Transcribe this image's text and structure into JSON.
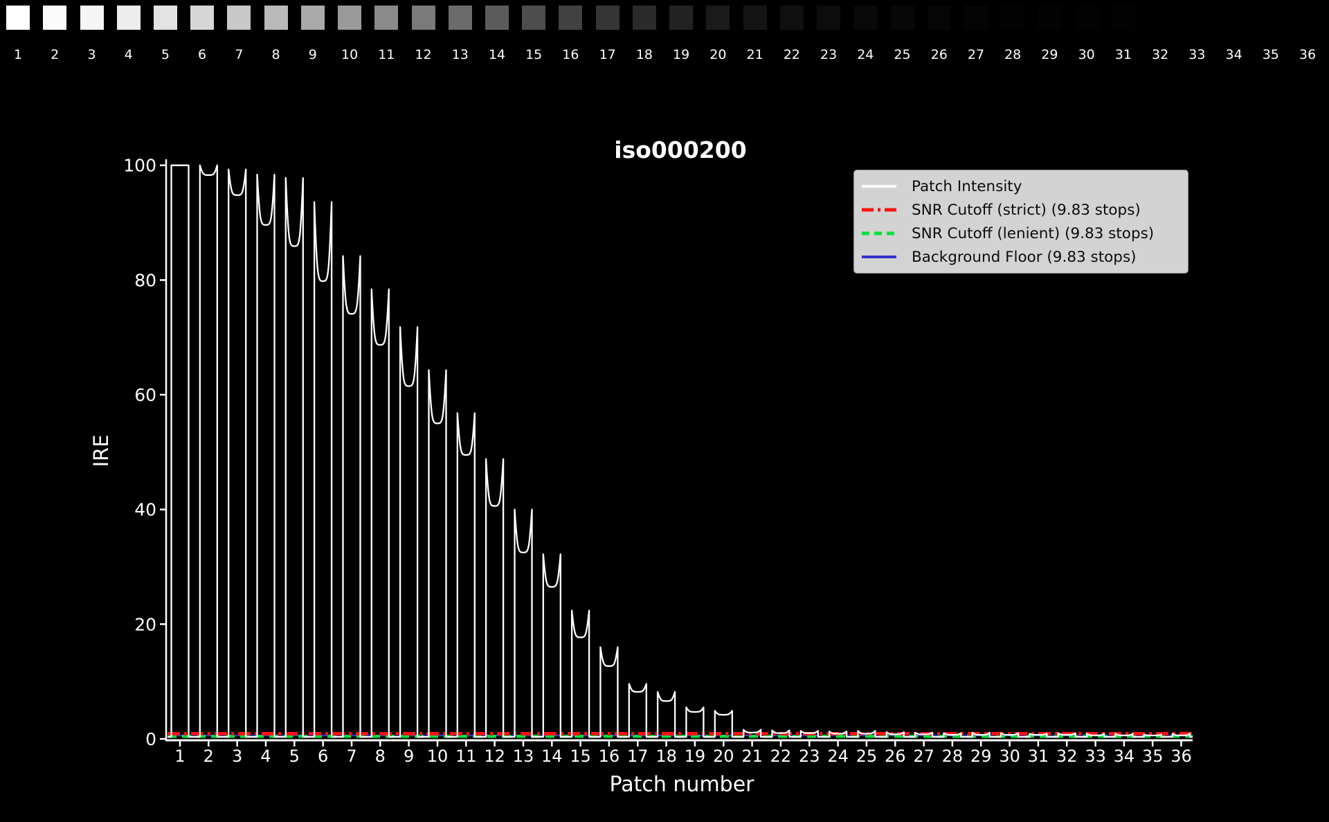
{
  "page": {
    "background": "#000000"
  },
  "patch_strip": {
    "labels": [
      "1",
      "2",
      "3",
      "4",
      "5",
      "6",
      "7",
      "8",
      "9",
      "10",
      "11",
      "12",
      "13",
      "14",
      "15",
      "16",
      "17",
      "18",
      "19",
      "20",
      "21",
      "22",
      "23",
      "24",
      "25",
      "26",
      "27",
      "28",
      "29",
      "30",
      "31",
      "32",
      "33",
      "34",
      "35",
      "36"
    ],
    "shades": [
      "#ffffff",
      "#fbfbfb",
      "#f5f5f5",
      "#ededed",
      "#e3e3e3",
      "#d6d6d6",
      "#c8c8c8",
      "#b9b9b9",
      "#aaaaaa",
      "#9a9a9a",
      "#8a8a8a",
      "#7a7a7a",
      "#6b6b6b",
      "#5c5c5c",
      "#4e4e4e",
      "#414141",
      "#353535",
      "#2b2b2b",
      "#222222",
      "#1a1a1a",
      "#141414",
      "#101010",
      "#0c0c0c",
      "#090909",
      "#070707",
      "#050505",
      "#040404",
      "#030303",
      "#030303",
      "#020202",
      "#020202",
      "#010101",
      "#010101",
      "#010101",
      "#010101",
      "#010101"
    ]
  },
  "chart_data": {
    "type": "line",
    "title": "iso000200",
    "xlabel": "Patch number",
    "ylabel": "IRE",
    "ylim": [
      0,
      100
    ],
    "y_ticks": [
      0,
      20,
      40,
      60,
      80,
      100
    ],
    "x_ticks": [
      1,
      2,
      3,
      4,
      5,
      6,
      7,
      8,
      9,
      10,
      11,
      12,
      13,
      14,
      15,
      16,
      17,
      18,
      19,
      20,
      21,
      22,
      23,
      24,
      25,
      26,
      27,
      28,
      29,
      30,
      31,
      32,
      33,
      34,
      35,
      36
    ],
    "grid": false,
    "background": "#000000",
    "text_color": "#ffffff",
    "legend_position": "upper right",
    "series": [
      {
        "name": "Patch Intensity",
        "kind": "waveform",
        "color": "#ffffff",
        "linestyle": "solid",
        "baseline_ire": 0.35,
        "patch_numbers": [
          1,
          2,
          3,
          4,
          5,
          6,
          7,
          8,
          9,
          10,
          11,
          12,
          13,
          14,
          15,
          16,
          17,
          18,
          19,
          20,
          21,
          22,
          23,
          24,
          25,
          26,
          27,
          28,
          29,
          30,
          31,
          32,
          33,
          34,
          35,
          36
        ],
        "peak_ire": [
          100,
          100,
          99.3,
          98.4,
          97.8,
          93.6,
          84.2,
          78.4,
          71.8,
          64.3,
          56.8,
          48.8,
          40.0,
          32.2,
          22.4,
          16.0,
          9.6,
          8.2,
          5.5,
          4.9,
          1.6,
          1.5,
          1.4,
          1.3,
          1.4,
          1.2,
          1.1,
          1.0,
          1.1,
          1.0,
          0.9,
          1.0,
          0.9,
          0.9,
          0.8,
          0.9
        ],
        "sag_ire": [
          100,
          98.3,
          94.8,
          89.6,
          85.9,
          79.8,
          74.1,
          68.7,
          61.5,
          55.0,
          49.5,
          40.6,
          32.5,
          26.5,
          17.7,
          12.7,
          8.2,
          6.6,
          4.7,
          4.2,
          1.1,
          1.0,
          1.0,
          0.9,
          0.9,
          0.8,
          0.8,
          0.7,
          0.7,
          0.7,
          0.7,
          0.7,
          0.6,
          0.6,
          0.6,
          0.6
        ]
      },
      {
        "name": "SNR Cutoff (strict) (9.83 stops)",
        "kind": "hline",
        "color": "#ff1111",
        "linestyle": "dashdot",
        "value_ire": 0.9
      },
      {
        "name": "SNR Cutoff (lenient) (9.83 stops)",
        "kind": "hline",
        "color": "#00e139",
        "linestyle": "dashed",
        "value_ire": 0.45
      },
      {
        "name": "Background Floor (9.83 stops)",
        "kind": "hline",
        "color": "#3232cd",
        "linestyle": "solid",
        "value_ire": 0.6
      }
    ]
  }
}
